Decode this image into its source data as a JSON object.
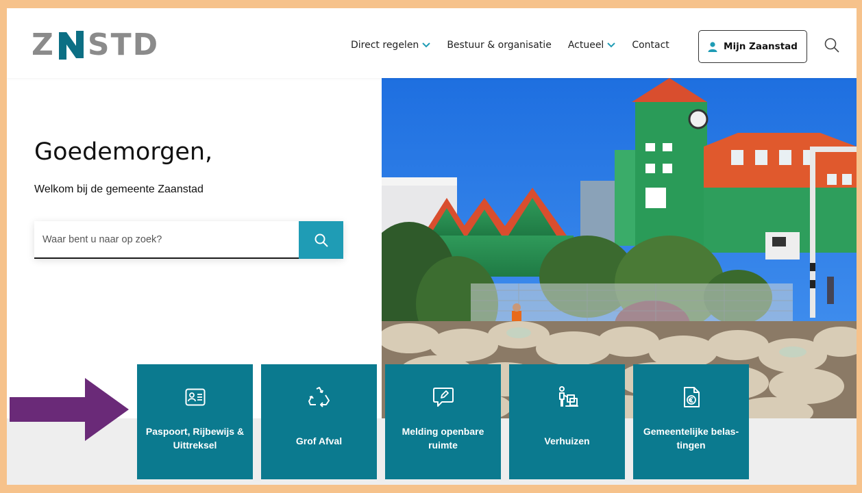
{
  "logo": {
    "text_left": "Z",
    "text_right": "STD",
    "alt": "ZNSTD"
  },
  "nav": {
    "items": [
      {
        "label": "Direct regelen",
        "dropdown": true
      },
      {
        "label": "Bestuur & organisatie",
        "dropdown": false
      },
      {
        "label": "Actueel",
        "dropdown": true
      },
      {
        "label": "Contact",
        "dropdown": false
      }
    ],
    "account_button": "Mijn Zaanstad"
  },
  "hero": {
    "greeting": "Goedemorgen,",
    "welcome": "Welkom bij de gemeente Zaanstad",
    "search_placeholder": "Waar bent u naar op zoek?"
  },
  "tiles": [
    {
      "line1": "Paspoort, Rijbewijs &",
      "line2": "Uittreksel",
      "icon": "id-card-icon"
    },
    {
      "line1": "Grof Afval",
      "line2": "",
      "icon": "recycle-icon"
    },
    {
      "line1": "Melding openbare",
      "line2": "ruimte",
      "icon": "report-chat-icon"
    },
    {
      "line1": "Verhuizen",
      "line2": "",
      "icon": "moving-icon"
    },
    {
      "line1": "Gemeentelijke belas-",
      "line2": "tingen",
      "icon": "tax-document-icon"
    }
  ],
  "colors": {
    "frame": "#f6c28b",
    "teal_tile": "#0b7a8f",
    "search_button": "#1f9cb5",
    "logo_gray": "#8b8b8b",
    "logo_teal": "#0c6f84",
    "arrow": "#6a2a78"
  }
}
